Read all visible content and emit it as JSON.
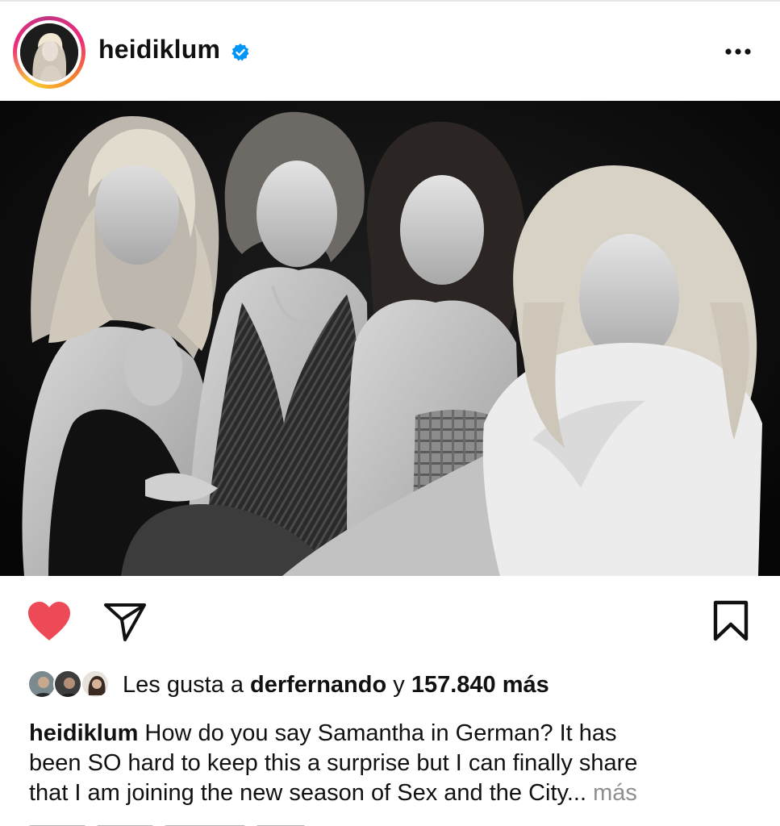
{
  "post": {
    "username": "heidiklum",
    "verified": true
  },
  "photo": {
    "description_tones": "black-and-white group portrait"
  },
  "actions": {
    "liked": true,
    "like_color": "#ed4956",
    "icons": [
      "heart-icon",
      "paper-plane-icon",
      "bookmark-icon"
    ]
  },
  "likes": {
    "prefix": "Les gusta a ",
    "user": "derfernando",
    "connector": " y ",
    "count": "157.840 más"
  },
  "caption": {
    "username": "heidiklum",
    "line1": " How do you say Samantha in German? It has",
    "line2": "been SO hard to keep this a surprise but I can finally share",
    "line3": "that I am joining the new season of Sex and the City...",
    "more": " más"
  },
  "colors": {
    "accent_blue": "#0095f6",
    "muted_text": "#8e8e8e"
  }
}
